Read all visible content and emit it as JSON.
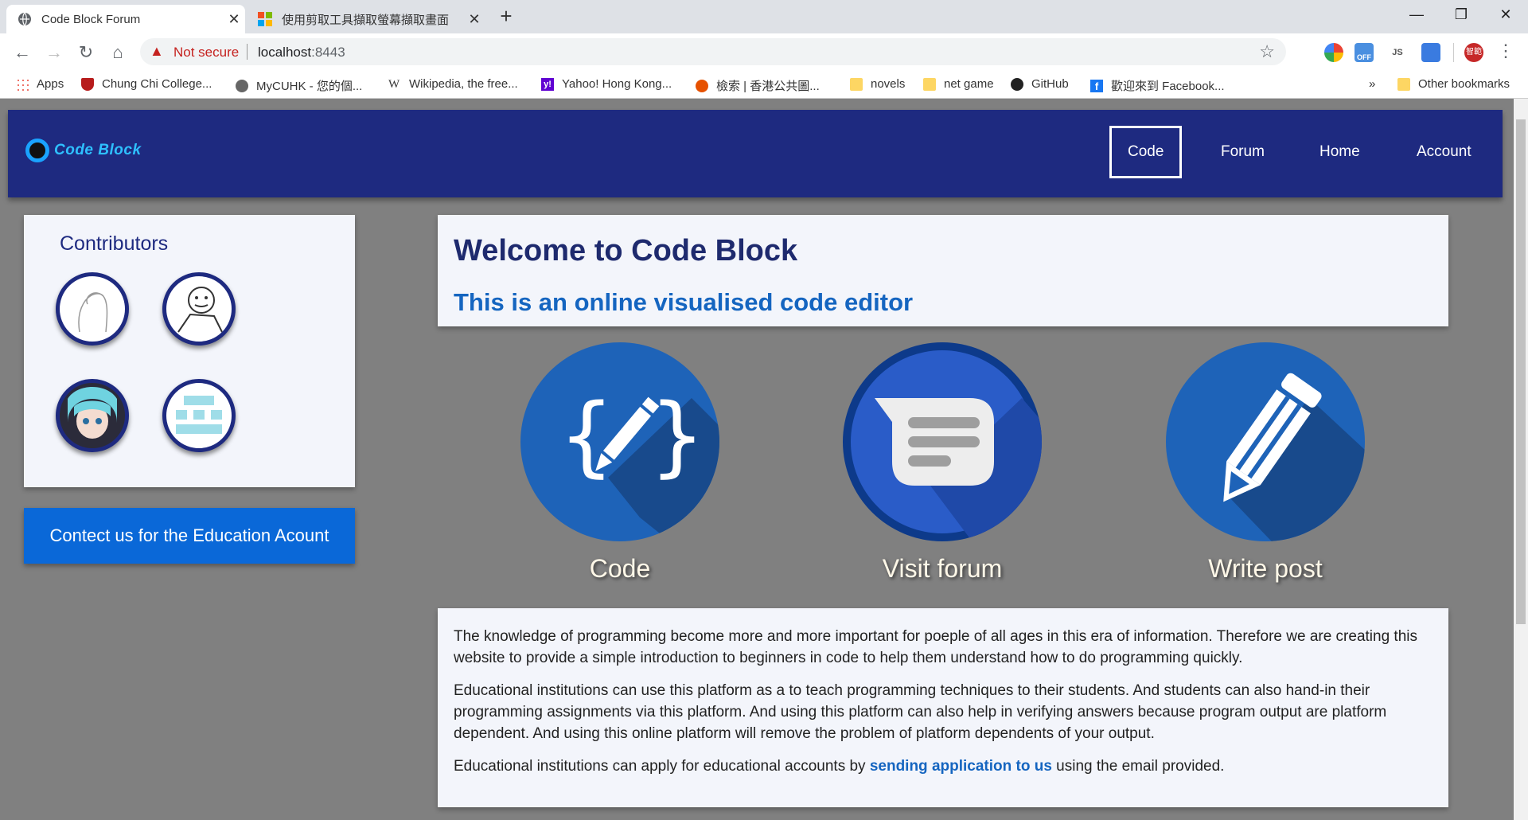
{
  "browser": {
    "tabs": [
      {
        "title": "Code Block Forum",
        "active": true
      },
      {
        "title": "使用剪取工具擷取螢幕擷取畫面",
        "active": false
      }
    ],
    "new_tab": "+",
    "window_controls": {
      "minimize": "—",
      "maximize": "❐",
      "close": "✕"
    },
    "security_label": "Not secure",
    "url_host": "localhost",
    "url_port": ":8443",
    "ext_off_label": "OFF",
    "ext_js_label": "JS",
    "profile_label": "智範",
    "bookmarks": [
      {
        "label": "Apps",
        "icon": "apps-icon"
      },
      {
        "label": "Chung Chi College...",
        "icon": "college-icon"
      },
      {
        "label": "MyCUHK - 您的個...",
        "icon": "globe-icon"
      },
      {
        "label": "Wikipedia, the free...",
        "icon": "wikipedia-icon"
      },
      {
        "label": "Yahoo! Hong Kong...",
        "icon": "yahoo-icon"
      },
      {
        "label": "檢索 | 香港公共圖...",
        "icon": "library-icon"
      },
      {
        "label": "novels",
        "icon": "folder-icon"
      },
      {
        "label": "net game",
        "icon": "folder-icon"
      },
      {
        "label": "GitHub",
        "icon": "github-icon"
      },
      {
        "label": "歡迎來到 Facebook...",
        "icon": "facebook-icon"
      }
    ],
    "bookmarks_overflow": "»",
    "other_bookmarks": "Other bookmarks"
  },
  "site": {
    "logo_text": "Code Block",
    "nav": [
      "Code",
      "Forum",
      "Home",
      "Account"
    ],
    "contributors_title": "Contributors",
    "contact_button": "Contect us for the Education Acount",
    "welcome_title": "Welcome to Code Block",
    "welcome_subtitle": "This is an online visualised code editor",
    "features": [
      {
        "label": "Code",
        "icon": "code-edit-icon"
      },
      {
        "label": "Visit forum",
        "icon": "message-icon"
      },
      {
        "label": "Write post",
        "icon": "pencil-icon"
      }
    ],
    "about": {
      "p1": "The knowledge of programming become more and more important for poeple of all ages in this era of information. Therefore we are creating this website to provide a simple introduction to beginners in code to help them understand how to do programming quickly.",
      "p2": "Educational institutions can use this platform as a to teach programming techniques to their students. And students can also hand-in their programming assignments via this platform. And using this platform can also help in verifying answers because program output are platform dependent. And using this online platform will remove the problem of platform dependents of your output.",
      "p3_before": "Educational institutions can apply for educational accounts by ",
      "p3_link": "sending application to us",
      "p3_after": " using the email provided."
    }
  },
  "colors": {
    "navbar": "#1e2a80",
    "feature_blue": "#1e63b8",
    "accent_link": "#1565c0",
    "page_bg": "#808080"
  }
}
